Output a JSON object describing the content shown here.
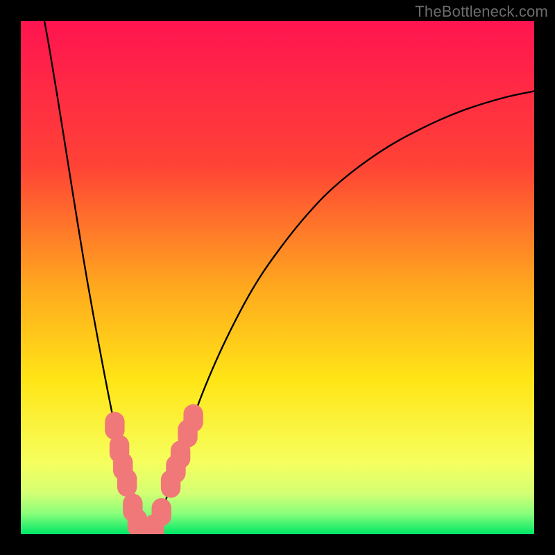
{
  "watermark": "TheBottleneck.com",
  "chart_data": {
    "type": "line",
    "title": "",
    "xlabel": "",
    "ylabel": "",
    "xlim": [
      0,
      100
    ],
    "ylim": [
      0,
      100
    ],
    "gradient_stops": [
      {
        "offset": 0,
        "color": "#ff1450"
      },
      {
        "offset": 28,
        "color": "#ff4236"
      },
      {
        "offset": 52,
        "color": "#ffa91e"
      },
      {
        "offset": 70,
        "color": "#ffe516"
      },
      {
        "offset": 86,
        "color": "#f6ff5e"
      },
      {
        "offset": 92,
        "color": "#d4ff74"
      },
      {
        "offset": 96,
        "color": "#89ff7a"
      },
      {
        "offset": 100,
        "color": "#00e667"
      }
    ],
    "series": [
      {
        "name": "bottleneck-curve",
        "points": [
          {
            "x": 4.5,
            "y": 100.5
          },
          {
            "x": 5.5,
            "y": 95.0
          },
          {
            "x": 7.0,
            "y": 86.0
          },
          {
            "x": 9.0,
            "y": 73.5
          },
          {
            "x": 11.0,
            "y": 61.0
          },
          {
            "x": 13.0,
            "y": 49.0
          },
          {
            "x": 15.0,
            "y": 38.0
          },
          {
            "x": 17.0,
            "y": 27.5
          },
          {
            "x": 19.0,
            "y": 17.5
          },
          {
            "x": 20.5,
            "y": 10.5
          },
          {
            "x": 22.0,
            "y": 4.0
          },
          {
            "x": 23.0,
            "y": 1.0
          },
          {
            "x": 24.0,
            "y": 0.0
          },
          {
            "x": 25.0,
            "y": 0.0
          },
          {
            "x": 26.0,
            "y": 1.0
          },
          {
            "x": 27.5,
            "y": 4.5
          },
          {
            "x": 30.0,
            "y": 12.0
          },
          {
            "x": 33.0,
            "y": 21.0
          },
          {
            "x": 36.0,
            "y": 29.0
          },
          {
            "x": 40.0,
            "y": 38.0
          },
          {
            "x": 45.0,
            "y": 47.5
          },
          {
            "x": 50.0,
            "y": 55.0
          },
          {
            "x": 56.0,
            "y": 62.5
          },
          {
            "x": 62.0,
            "y": 68.5
          },
          {
            "x": 70.0,
            "y": 74.5
          },
          {
            "x": 78.0,
            "y": 79.0
          },
          {
            "x": 86.0,
            "y": 82.5
          },
          {
            "x": 94.0,
            "y": 85.0
          },
          {
            "x": 100.0,
            "y": 86.3
          }
        ]
      }
    ],
    "markers": [
      {
        "x": 18.3,
        "y": 21.1,
        "r": 1.6
      },
      {
        "x": 19.2,
        "y": 16.6,
        "r": 1.6
      },
      {
        "x": 19.9,
        "y": 13.2,
        "r": 1.6
      },
      {
        "x": 20.7,
        "y": 10.0,
        "r": 1.6
      },
      {
        "x": 21.8,
        "y": 5.2,
        "r": 1.6
      },
      {
        "x": 22.7,
        "y": 2.2,
        "r": 1.6
      },
      {
        "x": 23.7,
        "y": 0.6,
        "r": 1.6
      },
      {
        "x": 24.8,
        "y": 0.2,
        "r": 1.6
      },
      {
        "x": 26.0,
        "y": 1.2,
        "r": 1.6
      },
      {
        "x": 27.4,
        "y": 4.3,
        "r": 1.6
      },
      {
        "x": 29.2,
        "y": 9.8,
        "r": 1.6
      },
      {
        "x": 30.2,
        "y": 12.7,
        "r": 1.6
      },
      {
        "x": 31.1,
        "y": 15.5,
        "r": 1.6
      },
      {
        "x": 32.5,
        "y": 19.6,
        "r": 1.6
      },
      {
        "x": 33.6,
        "y": 22.6,
        "r": 1.6
      }
    ],
    "marker_color": "#f07878"
  }
}
